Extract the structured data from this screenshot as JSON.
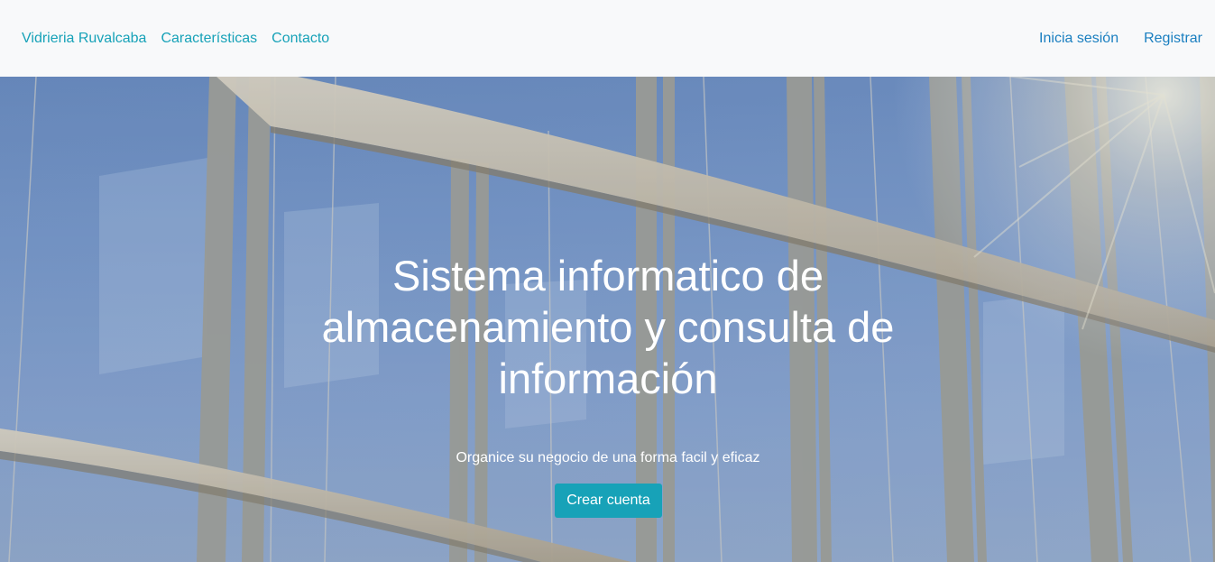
{
  "navbar": {
    "brand": "Vidrieria Ruvalcaba",
    "links": [
      "Características",
      "Contacto"
    ],
    "login": "Inicia sesión",
    "register": "Registrar"
  },
  "hero": {
    "title": "Sistema informatico de almacenamiento y consulta de información",
    "subtitle": "Organice su negocio de una forma facil y eficaz",
    "cta": "Crear cuenta",
    "background_image": "glass-building-facade"
  },
  "colors": {
    "nav_bg": "#f8f9fa",
    "brand_link": "#17a2b8",
    "auth_link": "#1a7fc0",
    "cta_bg": "#17a2b8",
    "hero_text": "#ffffff"
  }
}
